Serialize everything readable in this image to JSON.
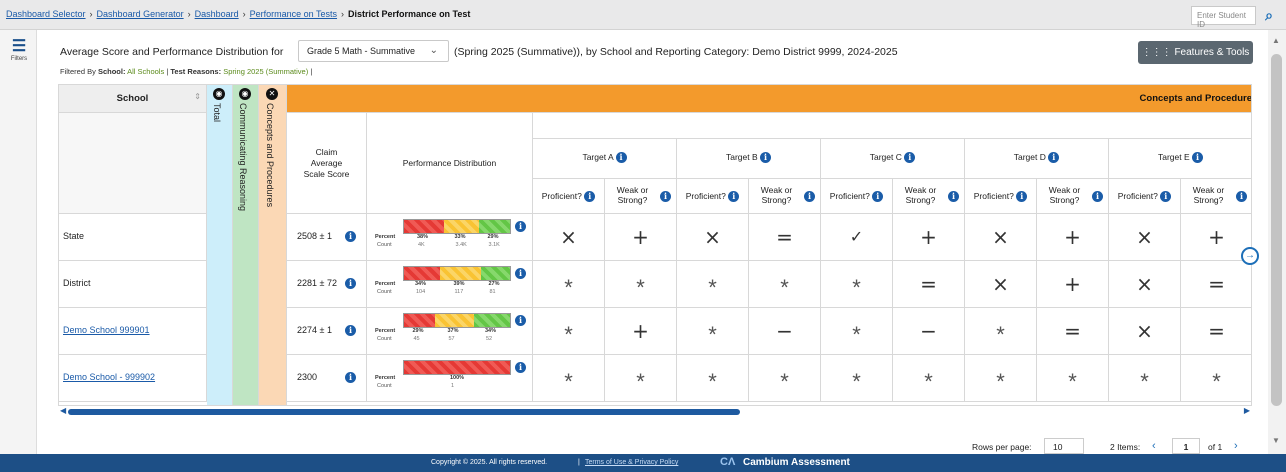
{
  "breadcrumb": {
    "items": [
      "Dashboard Selector",
      "Dashboard Generator",
      "Dashboard",
      "Performance on Tests"
    ],
    "current": "District Performance on Test"
  },
  "student_search": {
    "placeholder": "Enter Student ID",
    "icon": "search-icon"
  },
  "filters_label": "Filters",
  "title": {
    "prefix": "Average Score and Performance Distribution for",
    "test_select": "Grade 5 Math - Summative",
    "suffix": "(Spring 2025 (Summative)), by School and Reporting Category: Demo District 9999, 2024-2025"
  },
  "filtered_by": {
    "label": "Filtered By",
    "school_label": "School:",
    "school_value": "All Schools",
    "sep": "|",
    "reason_label": "Test Reasons:",
    "reason_value": "Spring 2025 (Summative)",
    "end": "|"
  },
  "features_button": "Features & Tools",
  "columns": {
    "school": "School",
    "total": "Total",
    "communicating": "Communicating Reasoning",
    "concepts": "Concepts and Procedures",
    "concepts_banner": "Concepts and Procedure",
    "claim_avg": [
      "Claim",
      "Average",
      "Scale Score"
    ],
    "perf_dist": "Performance Distribution",
    "targets": [
      "Target A",
      "Target B",
      "Target C",
      "Target D",
      "Target E"
    ],
    "proficient": "Proficient?",
    "weak_strong": [
      "Weak or",
      "Strong?"
    ]
  },
  "rows": [
    {
      "school": "State",
      "link": false,
      "score": "2508 ± 1",
      "dist": {
        "percent_label": "Percent",
        "count_label": "Count",
        "percents": [
          "38%",
          "33%",
          "29%"
        ],
        "counts": [
          "4K",
          "3.4K",
          "3.1K"
        ],
        "fractions": [
          0.38,
          0.33,
          0.29
        ]
      },
      "marks": [
        "×",
        "+",
        "×",
        "=",
        "✓",
        "+",
        "×",
        "+",
        "×",
        "+"
      ]
    },
    {
      "school": "District",
      "link": false,
      "score": "2281 ± 72",
      "dist": {
        "percent_label": "Percent",
        "count_label": "Count",
        "percents": [
          "34%",
          "39%",
          "27%"
        ],
        "counts": [
          "104",
          "117",
          "81"
        ],
        "fractions": [
          0.34,
          0.39,
          0.27
        ]
      },
      "marks": [
        "*",
        "*",
        "*",
        "*",
        "*",
        "=",
        "×",
        "+",
        "×",
        "="
      ]
    },
    {
      "school": "Demo School 999901",
      "link": true,
      "score": "2274 ± 1",
      "dist": {
        "percent_label": "Percent",
        "count_label": "Count",
        "percents": [
          "29%",
          "37%",
          "34%"
        ],
        "counts": [
          "45",
          "57",
          "52"
        ],
        "fractions": [
          0.29,
          0.37,
          0.34
        ]
      },
      "marks": [
        "*",
        "+",
        "*",
        "−",
        "*",
        "−",
        "*",
        "=",
        "×",
        "="
      ]
    },
    {
      "school": "Demo School - 999902",
      "link": true,
      "score": "2300",
      "dist": {
        "percent_label": "Percent",
        "count_label": "Count",
        "percents": [
          "100%"
        ],
        "counts": [
          "1"
        ],
        "fractions": [
          1.0
        ]
      },
      "marks": [
        "*",
        "*",
        "*",
        "*",
        "*",
        "*",
        "*",
        "*",
        "*",
        "*"
      ]
    }
  ],
  "pagination": {
    "rows_label": "Rows per page:",
    "rows_value": "10",
    "items": "2 Items:",
    "page": "1",
    "of": "of 1"
  },
  "footer": {
    "copyright": "Copyright © 2025. All rights reserved.",
    "sep": "|",
    "terms": "Terms of Use & Privacy Policy",
    "brand": "Cambium Assessment"
  },
  "colors": {
    "orange": "#f39a2c",
    "total_col": "#cdeefa",
    "comm_col": "#bfe5c3",
    "conc_col": "#fbd8b5",
    "footer": "#1d4f86"
  }
}
